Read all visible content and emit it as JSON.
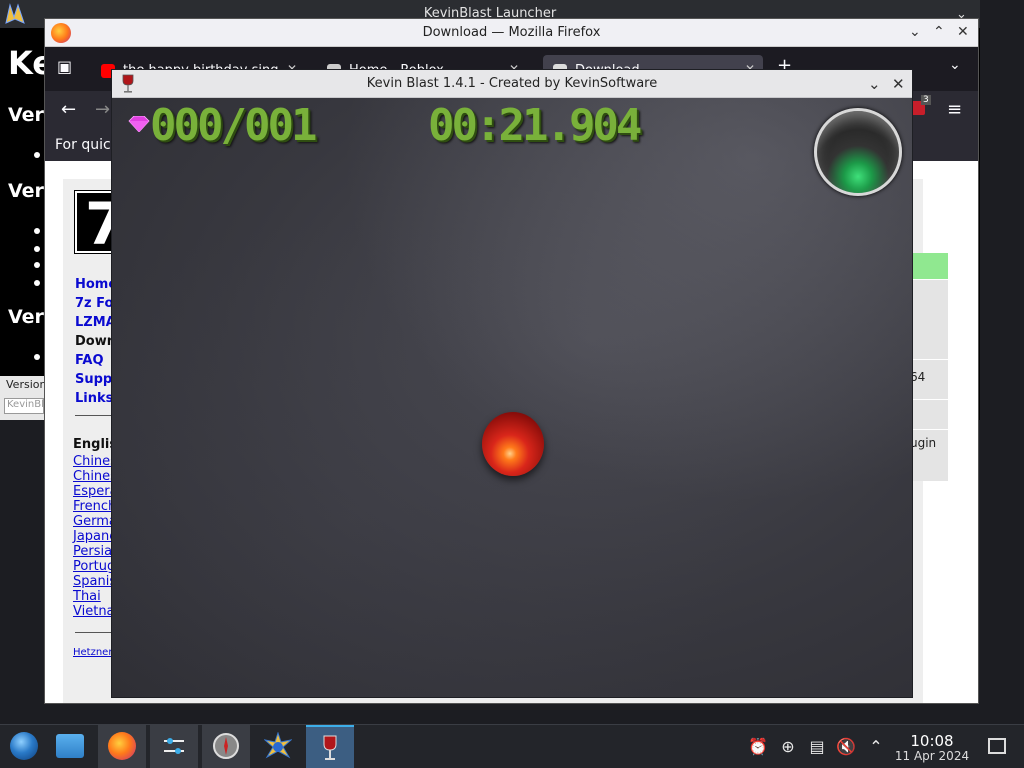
{
  "launcher": {
    "title": "KevinBlast Launcher",
    "heading_partial": "Ke",
    "section_labels": [
      "Versi",
      "Vers",
      "Vers"
    ],
    "version_label": "Version",
    "version_input_value": "KevinBla"
  },
  "firefox": {
    "window_title": "Download — Mozilla Firefox",
    "tabs": [
      {
        "label": "the happy birthday sing",
        "favicon_color": "#ff0000",
        "active": false
      },
      {
        "label": "Home - Roblox",
        "favicon_color": "#cccccc",
        "active": false
      },
      {
        "label": "Download",
        "favicon_color": "#dddddd",
        "active": true
      }
    ],
    "bookmarks_text": "For quicl",
    "extension_badge": "3",
    "page": {
      "logo_text": "7",
      "nav_links": [
        {
          "label": "Home",
          "current": false
        },
        {
          "label": "7z For",
          "current": false
        },
        {
          "label": "LZMA",
          "current": false
        },
        {
          "label": "Down",
          "current": true
        },
        {
          "label": "FAQ",
          "current": false
        },
        {
          "label": "Suppo",
          "current": false
        },
        {
          "label": "Links",
          "current": false
        }
      ],
      "language_heading": "Englis",
      "languages": [
        "Chines",
        "Chines",
        "Espera",
        "French",
        "Germa",
        "Japane",
        "Persia",
        "Portug",
        "Spanis",
        "Thai",
        "Vietna"
      ],
      "footer_link": "Hetzner",
      "right_cells": [
        "64",
        "ugin"
      ]
    }
  },
  "game": {
    "window_title": "Kevin Blast 1.4.1 - Created by KevinSoftware",
    "gem_counter": "000/001",
    "timer": "00:21.904",
    "gem_color": "#e040e0",
    "hud_color": "#79b13a",
    "status_light_color": "#3fe07a"
  },
  "taskbar": {
    "apps": [
      {
        "name": "start-menu",
        "state": "idle"
      },
      {
        "name": "file-manager",
        "state": "idle"
      },
      {
        "name": "firefox",
        "state": "running"
      },
      {
        "name": "task-switcher",
        "state": "running"
      },
      {
        "name": "compass",
        "state": "running"
      },
      {
        "name": "kevinblast-launcher",
        "state": "idle"
      },
      {
        "name": "wine-glass",
        "state": "active"
      }
    ],
    "tray_icons": [
      "alarm-icon",
      "update-icon",
      "clipboard-icon",
      "volume-muted-icon",
      "chevron-up-icon"
    ],
    "clock_time": "10:08",
    "clock_date": "11 Apr 2024"
  }
}
